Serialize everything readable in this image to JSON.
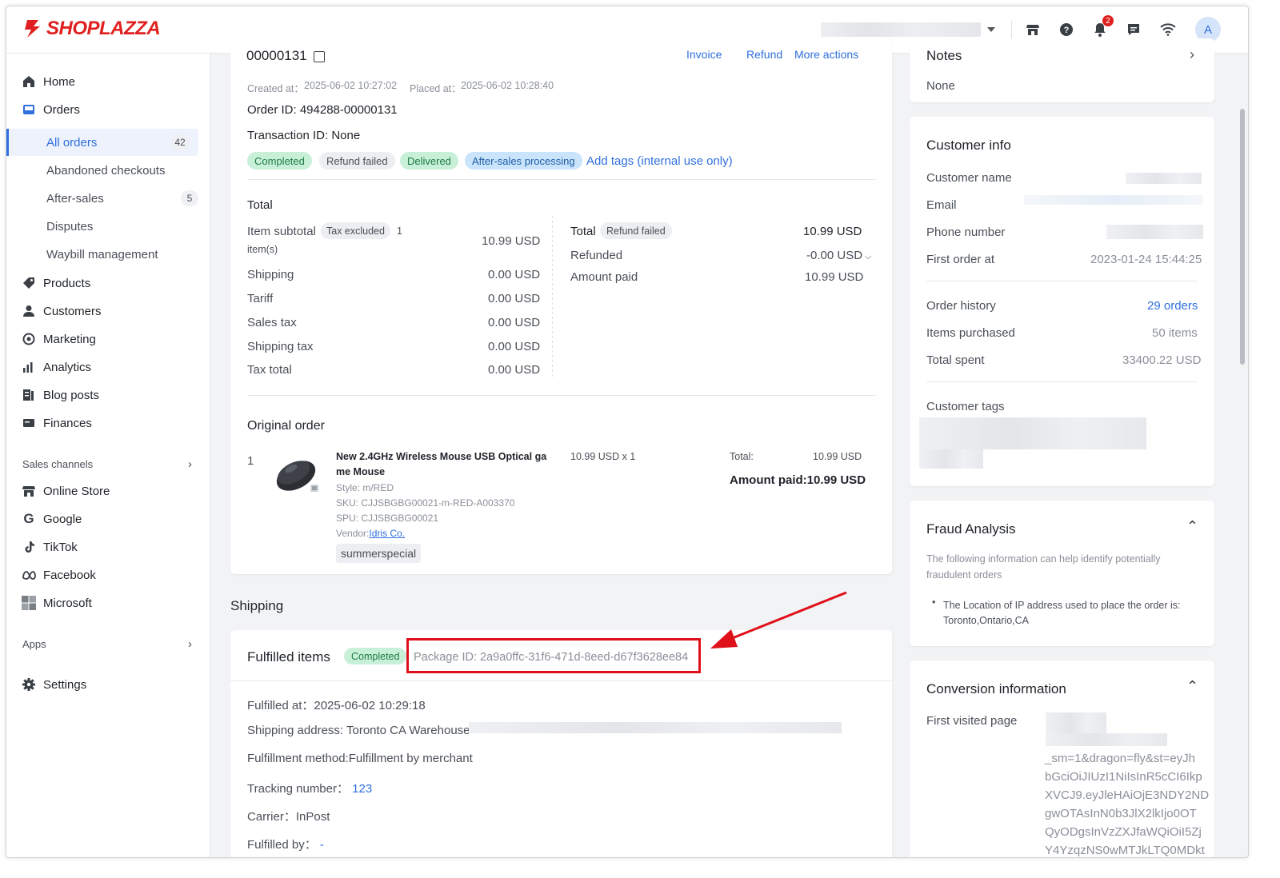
{
  "brand": {
    "name": "SHOPLAZZA",
    "accent": "#e02020",
    "link": "#2f6fde"
  },
  "topbar": {
    "notification_count": "2",
    "avatar_initial": "A",
    "icons": [
      "online-store-icon",
      "help-icon",
      "bell-icon",
      "message-icon",
      "wifi-icon"
    ]
  },
  "sidebar": {
    "items": {
      "home": "Home",
      "orders": "Orders",
      "products": "Products",
      "customers": "Customers",
      "marketing": "Marketing",
      "analytics": "Analytics",
      "blog_posts": "Blog posts",
      "finances": "Finances",
      "online_store": "Online Store",
      "google": "Google",
      "tiktok": "TikTok",
      "facebook": "Facebook",
      "microsoft": "Microsoft",
      "settings": "Settings"
    },
    "orders_sub": [
      {
        "label": "All orders",
        "count": "42"
      },
      {
        "label": "Abandoned checkouts",
        "count": ""
      },
      {
        "label": "After-sales",
        "count": "5"
      },
      {
        "label": "Disputes",
        "count": ""
      },
      {
        "label": "Waybill management",
        "count": ""
      }
    ],
    "sales_channels": "Sales channels",
    "apps": "Apps"
  },
  "order": {
    "number_partial": "00000131",
    "actions": {
      "invoice": "Invoice",
      "refund": "Refund",
      "more": "More actions"
    },
    "created_label": "Created at：",
    "created": "2025-06-02 10:27:02",
    "placed_label": "Placed at：",
    "placed": "2025-06-02 10:28:40",
    "order_id": "Order ID: 494288-00000131",
    "transaction_id": "Transaction ID: None",
    "tags": [
      "Completed",
      "Refund failed",
      "Delivered",
      "After-sales processing"
    ],
    "add_tags": "Add tags (internal use only)"
  },
  "totals": {
    "heading": "Total",
    "item_subtotal_label": "Item subtotal",
    "tax_badge": "Tax excluded",
    "item_count": "1",
    "items_word": "item(s)",
    "item_subtotal": "10.99 USD",
    "rows": [
      {
        "label": "Shipping",
        "value": "0.00 USD"
      },
      {
        "label": "Tariff",
        "value": "0.00 USD"
      },
      {
        "label": "Sales tax",
        "value": "0.00 USD"
      },
      {
        "label": "Shipping tax",
        "value": "0.00 USD"
      },
      {
        "label": "Tax total",
        "value": "0.00 USD"
      }
    ],
    "right_total_label": "Total",
    "right_badge": "Refund failed",
    "right_total": "10.99 USD",
    "refunded_label": "Refunded",
    "refunded": "-0.00 USD",
    "amount_paid_label": "Amount paid",
    "amount_paid": "10.99 USD"
  },
  "original_order": {
    "heading": "Original order",
    "index": "1",
    "product_line1": "New 2.4GHz Wireless Mouse USB Optical ga",
    "product_line2": "me Mouse",
    "style": "Style: m/RED",
    "sku": "SKU: CJJSBGBG00021-m-RED-A003370",
    "spu": "SPU: CJJSBGBG00021",
    "vendor_label": "Vendor:",
    "vendor": "Idris Co.",
    "tag": "summerspecial",
    "price": "10.99 USD x 1",
    "total_label": "Total:",
    "total": "10.99 USD",
    "amount_paid": "Amount paid:10.99 USD"
  },
  "shipping": {
    "heading": "Shipping",
    "fulfilled_items": "Fulfilled items",
    "status": "Completed",
    "package_id": "Package ID: 2a9a0ffc-31f6-471d-8eed-d67f3628ee84",
    "fulfilled_at_label": "Fulfilled at：",
    "fulfilled_at": "2025-06-02 10:29:18",
    "address": "Shipping address: Toronto CA Warehouse",
    "method": "Fulfillment method:Fulfillment by merchant",
    "tracking_label": "Tracking number：",
    "tracking": "123",
    "carrier_label": "Carrier：",
    "carrier": "InPost",
    "fulfilled_by_label": "Fulfilled by：",
    "fulfilled_by": "-"
  },
  "notes": {
    "heading": "Notes",
    "value": "None"
  },
  "customer": {
    "heading": "Customer info",
    "name_label": "Customer name",
    "email_label": "Email",
    "phone_label": "Phone number",
    "first_order_label": "First order at",
    "first_order": "2023-01-24 15:44:25",
    "history_label": "Order history",
    "history": "29 orders",
    "items_label": "Items purchased",
    "items": "50 items",
    "spent_label": "Total spent",
    "spent": "33400.22 USD",
    "tags_label": "Customer tags"
  },
  "fraud": {
    "heading": "Fraud Analysis",
    "desc_line1": "The following information can help identify potentially",
    "desc_line2": "fraudulent orders",
    "item_line1": "The Location of IP address used to place the order is:",
    "item_line2": "Toronto,Ontario,CA"
  },
  "conversion": {
    "heading": "Conversion information",
    "first_visited_label": "First visited page",
    "url_lines": [
      "_sm=1&dragon=fly&st=eyJh",
      "bGciOiJIUzI1NiIsInR5cCI6Ikp",
      "XVCJ9.eyJleHAiOjE3NDY2ND",
      "gwOTAsInN0b3JlX2lkIjo0OT",
      "QyODgsInVzZXJfaWQiOiI5Zj",
      "Y4YzqzNS0wMTJkLTQ0MDkt"
    ]
  }
}
